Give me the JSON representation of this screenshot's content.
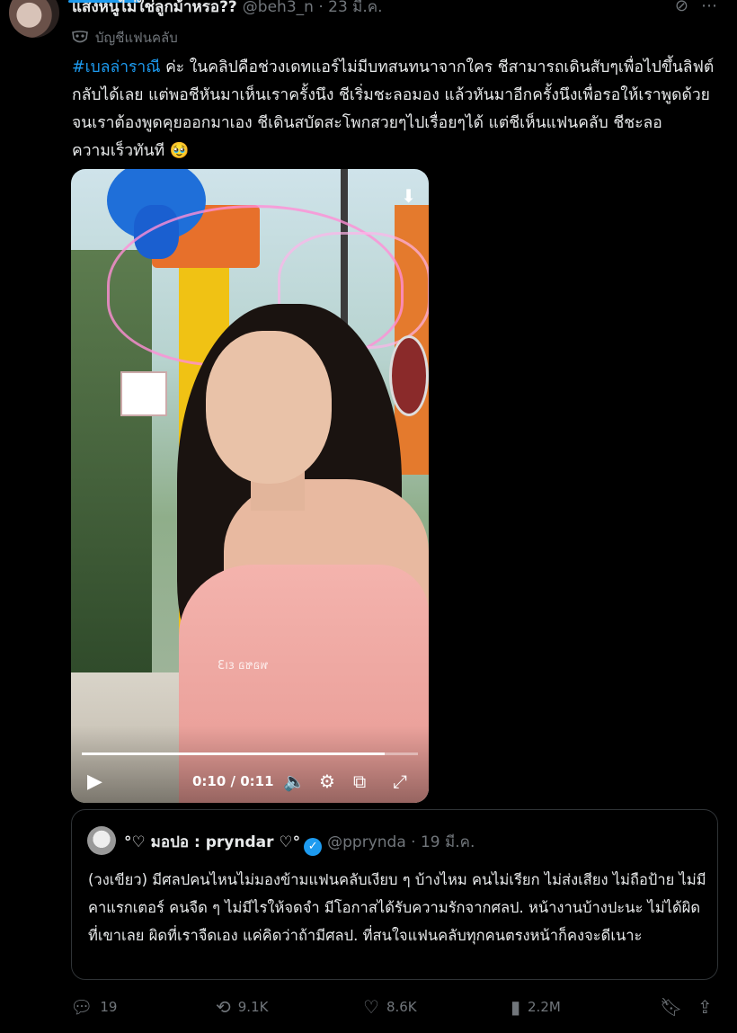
{
  "tweet": {
    "author_name": "แสงหนูไม่ใช่ลูกม้าหรอ??",
    "author_handle": "@beh3_n · 23 มี.ค.",
    "community_label": "บัญชีแฟนคลับ",
    "hashtag": "#เบลล่าราณี",
    "text_part1": " ค่ะ ในคลิปคือช่วงเดทแอร์ไม่มีบทสนทนาจากใคร ชีสามารถเดินสับๆเพื่อไปขึ้นลิฟต์กลับได้เลย แต่พอชีหันมาเห็นเราครั้งนึง ชีเริ่มชะลอมอง แล้วหันมาอีกครั้งนึงเพื่อรอให้เราพูดด้วย จนเราต้องพูดคุยออกมาเอง ชีเดินสบัดสะโพกสวยๆไปเรื่อยๆได้ แต่ชีเห็นแฟนคลับ ชีชะลอความเร็วทันที 🥹"
  },
  "video": {
    "watermark": "พอชอ ɛı3",
    "time_display": "0:10 / 0:11",
    "progress": 0.9,
    "icons": [
      "play-icon",
      "volume-icon",
      "settings-icon",
      "pip-icon",
      "fullscreen-icon",
      "download-icon"
    ]
  },
  "quote": {
    "name": "°♡ มอปอ : pryndar ♡°",
    "handle": "@pprynda · 19 มี.ค.",
    "text": "(วงเขียว) มีศลปคนไหนไม่มองข้ามแฟนคลับเงียบ ๆ บ้างไหม  คนไม่เรียก ไม่ส่งเสียง ไม่ถือป้าย ไม่มีคาแรกเตอร์ คนจืด ๆ ไม่มีไรให้จดจำ มีโอกาสได้รับความรักจากศลป. หน้างานบ้างปะนะ ไม่ได้ผิดที่เขาเลย ผิดที่เราจืดเอง แค่คิดว่าถ้ามีศลป. ที่สนใจแฟนคลับทุกคนตรงหน้าก็คงจะดีเนาะ"
  },
  "actions": {
    "replies": "19",
    "reposts": "9.1K",
    "likes": "8.6K",
    "views": "2.2M"
  },
  "colors": {
    "accent": "#1d9bf0",
    "muted": "#71767b",
    "text": "#e7e9ea",
    "background": "#000000"
  }
}
